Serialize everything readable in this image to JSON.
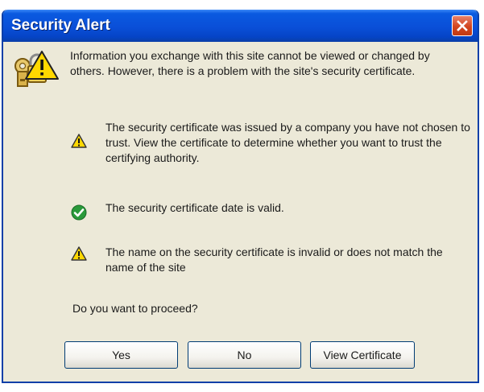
{
  "window": {
    "title": "Security Alert",
    "accent": "#0a4fd8",
    "close_color": "#d2451e"
  },
  "intro": {
    "icon": "lock-warning-icon",
    "text": "Information you exchange with this site cannot be viewed or changed by others. However, there is a problem with the site's security certificate."
  },
  "items": [
    {
      "icon": "warning-icon",
      "status": "warning",
      "text": "The security certificate was issued by a company you have not chosen to trust. View the certificate to determine whether you want to trust the certifying authority."
    },
    {
      "icon": "check-icon",
      "status": "ok",
      "text": "The security certificate date is valid."
    },
    {
      "icon": "warning-icon",
      "status": "warning",
      "text": "The name on the security certificate is invalid or does not match the name of the site"
    }
  ],
  "question": "Do you want to proceed?",
  "buttons": {
    "yes": "Yes",
    "no": "No",
    "view_certificate": "View Certificate"
  }
}
